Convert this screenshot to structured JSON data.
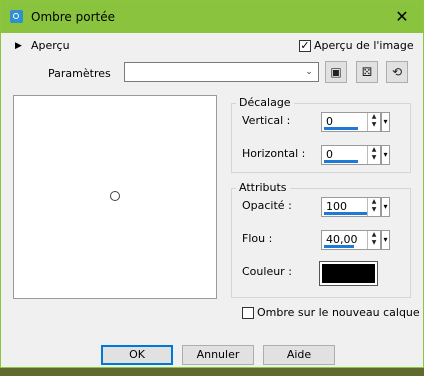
{
  "window": {
    "title": "Ombre portée",
    "close_glyph": "✕",
    "accent": "#8ac43f"
  },
  "preview_section": {
    "expander_glyph": "▶",
    "label": "Aperçu",
    "image_preview_checkbox": {
      "label": "Aperçu de l'image",
      "checked": true,
      "glyph": "✓"
    }
  },
  "parametres": {
    "label": "Paramètres",
    "selected_value": "",
    "dropdown_glyph": "⌄",
    "buttons": [
      {
        "name": "save-preset-button",
        "icon": "save-icon",
        "glyph": "▣"
      },
      {
        "name": "random-preset-button",
        "icon": "dice-icon",
        "glyph": "⚄"
      },
      {
        "name": "reset-preset-button",
        "icon": "reset-icon",
        "glyph": "⟲"
      }
    ]
  },
  "decalage": {
    "legend": "Décalage",
    "vertical": {
      "label": "Vertical :",
      "value": "0"
    },
    "horizontal": {
      "label": "Horizontal :",
      "value": "0"
    }
  },
  "attributs": {
    "legend": "Attributs",
    "opacite": {
      "label": "Opacité :",
      "value": "100"
    },
    "flou": {
      "label": "Flou :",
      "value": "40,00"
    },
    "couleur": {
      "label": "Couleur :",
      "color": "#000000"
    }
  },
  "new_layer_checkbox": {
    "label": "Ombre sur le nouveau calque",
    "checked": false
  },
  "spin_glyphs": {
    "up": "▲",
    "down": "▼",
    "drop": "▾"
  },
  "buttons": {
    "ok": "OK",
    "annuler": "Annuler",
    "aide": "Aide"
  }
}
